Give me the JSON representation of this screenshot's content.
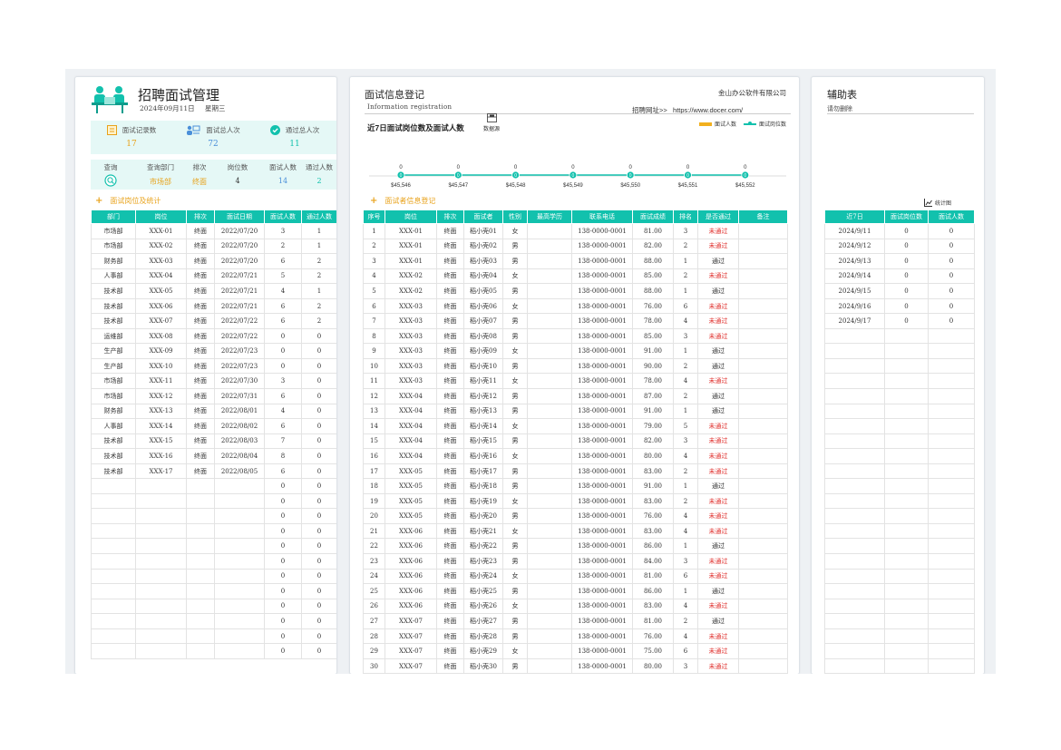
{
  "left": {
    "title": "招聘面试管理",
    "date": "2024年09月11日",
    "weekday": "星期三",
    "stats": [
      {
        "label": "面试记录数",
        "value": "17"
      },
      {
        "label": "面试总人次",
        "value": "72"
      },
      {
        "label": "通过总人次",
        "value": "11"
      }
    ],
    "query": {
      "headers": [
        "查询",
        "查询部门",
        "排次",
        "岗位数",
        "面试人数",
        "通过人数"
      ],
      "dept": "市场部",
      "round": "终面",
      "positions": "4",
      "interviewees": "14",
      "passed": "2"
    },
    "section_title": "面试岗位及统计",
    "table": {
      "headers": [
        "部门",
        "岗位",
        "排次",
        "面试日期",
        "面试人数",
        "通过人数"
      ],
      "rows": [
        [
          "市场部",
          "XXX-01",
          "终面",
          "2022/07/20",
          "3",
          "1"
        ],
        [
          "市场部",
          "XXX-02",
          "终面",
          "2022/07/20",
          "2",
          "1"
        ],
        [
          "财务部",
          "XXX-03",
          "终面",
          "2022/07/20",
          "6",
          "2"
        ],
        [
          "人事部",
          "XXX-04",
          "终面",
          "2022/07/21",
          "5",
          "2"
        ],
        [
          "技术部",
          "XXX-05",
          "终面",
          "2022/07/21",
          "4",
          "1"
        ],
        [
          "技术部",
          "XXX-06",
          "终面",
          "2022/07/21",
          "6",
          "2"
        ],
        [
          "技术部",
          "XXX-07",
          "终面",
          "2022/07/22",
          "6",
          "2"
        ],
        [
          "运维部",
          "XXX-08",
          "终面",
          "2022/07/22",
          "0",
          "0"
        ],
        [
          "生产部",
          "XXX-09",
          "终面",
          "2022/07/23",
          "0",
          "0"
        ],
        [
          "生产部",
          "XXX-10",
          "终面",
          "2022/07/23",
          "0",
          "0"
        ],
        [
          "市场部",
          "XXX-11",
          "终面",
          "2022/07/30",
          "3",
          "0"
        ],
        [
          "市场部",
          "XXX-12",
          "终面",
          "2022/07/31",
          "6",
          "0"
        ],
        [
          "财务部",
          "XXX-13",
          "终面",
          "2022/08/01",
          "4",
          "0"
        ],
        [
          "人事部",
          "XXX-14",
          "终面",
          "2022/08/02",
          "6",
          "0"
        ],
        [
          "技术部",
          "XXX-15",
          "终面",
          "2022/08/03",
          "7",
          "0"
        ],
        [
          "技术部",
          "XXX-16",
          "终面",
          "2022/08/04",
          "8",
          "0"
        ],
        [
          "技术部",
          "XXX-17",
          "终面",
          "2022/08/05",
          "6",
          "0"
        ],
        [
          "",
          "",
          "",
          "",
          "0",
          "0"
        ],
        [
          "",
          "",
          "",
          "",
          "0",
          "0"
        ],
        [
          "",
          "",
          "",
          "",
          "0",
          "0"
        ],
        [
          "",
          "",
          "",
          "",
          "0",
          "0"
        ],
        [
          "",
          "",
          "",
          "",
          "0",
          "0"
        ],
        [
          "",
          "",
          "",
          "",
          "0",
          "0"
        ],
        [
          "",
          "",
          "",
          "",
          "0",
          "0"
        ],
        [
          "",
          "",
          "",
          "",
          "0",
          "0"
        ],
        [
          "",
          "",
          "",
          "",
          "0",
          "0"
        ],
        [
          "",
          "",
          "",
          "",
          "0",
          "0"
        ],
        [
          "",
          "",
          "",
          "",
          "0",
          "0"
        ],
        [
          "",
          "",
          "",
          "",
          "0",
          "0"
        ]
      ]
    }
  },
  "mid": {
    "title": "面试信息登记",
    "subtitle": "Information registration",
    "company": "金山办公软件有限公司",
    "url_label": "招聘网址>>",
    "url": "https://www.docer.com/",
    "datasource_label": "数据源",
    "section_title": "面试者信息登记",
    "table": {
      "headers": [
        "序号",
        "岗位",
        "排次",
        "面试者",
        "性别",
        "最高学历",
        "联系电话",
        "面试成绩",
        "排名",
        "是否通过",
        "备注"
      ],
      "rows": [
        [
          "1",
          "XXX-01",
          "终面",
          "稻小壳01",
          "女",
          "",
          "138-0000-0001",
          "81.00",
          "3",
          "未通过",
          ""
        ],
        [
          "2",
          "XXX-01",
          "终面",
          "稻小壳02",
          "男",
          "",
          "138-0000-0001",
          "82.00",
          "2",
          "未通过",
          ""
        ],
        [
          "3",
          "XXX-01",
          "终面",
          "稻小壳03",
          "男",
          "",
          "138-0000-0001",
          "88.00",
          "1",
          "通过",
          ""
        ],
        [
          "4",
          "XXX-02",
          "终面",
          "稻小壳04",
          "女",
          "",
          "138-0000-0001",
          "85.00",
          "2",
          "未通过",
          ""
        ],
        [
          "5",
          "XXX-02",
          "终面",
          "稻小壳05",
          "男",
          "",
          "138-0000-0001",
          "88.00",
          "1",
          "通过",
          ""
        ],
        [
          "6",
          "XXX-03",
          "终面",
          "稻小壳06",
          "女",
          "",
          "138-0000-0001",
          "76.00",
          "6",
          "未通过",
          ""
        ],
        [
          "7",
          "XXX-03",
          "终面",
          "稻小壳07",
          "男",
          "",
          "138-0000-0001",
          "78.00",
          "4",
          "未通过",
          ""
        ],
        [
          "8",
          "XXX-03",
          "终面",
          "稻小壳08",
          "男",
          "",
          "138-0000-0001",
          "85.00",
          "3",
          "未通过",
          ""
        ],
        [
          "9",
          "XXX-03",
          "终面",
          "稻小壳09",
          "女",
          "",
          "138-0000-0001",
          "91.00",
          "1",
          "通过",
          ""
        ],
        [
          "10",
          "XXX-03",
          "终面",
          "稻小壳10",
          "男",
          "",
          "138-0000-0001",
          "90.00",
          "2",
          "通过",
          ""
        ],
        [
          "11",
          "XXX-03",
          "终面",
          "稻小壳11",
          "女",
          "",
          "138-0000-0001",
          "78.00",
          "4",
          "未通过",
          ""
        ],
        [
          "12",
          "XXX-04",
          "终面",
          "稻小壳12",
          "男",
          "",
          "138-0000-0001",
          "87.00",
          "2",
          "通过",
          ""
        ],
        [
          "13",
          "XXX-04",
          "终面",
          "稻小壳13",
          "男",
          "",
          "138-0000-0001",
          "91.00",
          "1",
          "通过",
          ""
        ],
        [
          "14",
          "XXX-04",
          "终面",
          "稻小壳14",
          "女",
          "",
          "138-0000-0001",
          "79.00",
          "5",
          "未通过",
          ""
        ],
        [
          "15",
          "XXX-04",
          "终面",
          "稻小壳15",
          "男",
          "",
          "138-0000-0001",
          "82.00",
          "3",
          "未通过",
          ""
        ],
        [
          "16",
          "XXX-04",
          "终面",
          "稻小壳16",
          "女",
          "",
          "138-0000-0001",
          "80.00",
          "4",
          "未通过",
          ""
        ],
        [
          "17",
          "XXX-05",
          "终面",
          "稻小壳17",
          "男",
          "",
          "138-0000-0001",
          "83.00",
          "2",
          "未通过",
          ""
        ],
        [
          "18",
          "XXX-05",
          "终面",
          "稻小壳18",
          "男",
          "",
          "138-0000-0001",
          "91.00",
          "1",
          "通过",
          ""
        ],
        [
          "19",
          "XXX-05",
          "终面",
          "稻小壳19",
          "女",
          "",
          "138-0000-0001",
          "83.00",
          "2",
          "未通过",
          ""
        ],
        [
          "20",
          "XXX-05",
          "终面",
          "稻小壳20",
          "男",
          "",
          "138-0000-0001",
          "76.00",
          "4",
          "未通过",
          ""
        ],
        [
          "21",
          "XXX-06",
          "终面",
          "稻小壳21",
          "女",
          "",
          "138-0000-0001",
          "83.00",
          "4",
          "未通过",
          ""
        ],
        [
          "22",
          "XXX-06",
          "终面",
          "稻小壳22",
          "男",
          "",
          "138-0000-0001",
          "86.00",
          "1",
          "通过",
          ""
        ],
        [
          "23",
          "XXX-06",
          "终面",
          "稻小壳23",
          "男",
          "",
          "138-0000-0001",
          "84.00",
          "3",
          "未通过",
          ""
        ],
        [
          "24",
          "XXX-06",
          "终面",
          "稻小壳24",
          "女",
          "",
          "138-0000-0001",
          "81.00",
          "6",
          "未通过",
          ""
        ],
        [
          "25",
          "XXX-06",
          "终面",
          "稻小壳25",
          "男",
          "",
          "138-0000-0001",
          "86.00",
          "1",
          "通过",
          ""
        ],
        [
          "26",
          "XXX-06",
          "终面",
          "稻小壳26",
          "女",
          "",
          "138-0000-0001",
          "83.00",
          "4",
          "未通过",
          ""
        ],
        [
          "27",
          "XXX-07",
          "终面",
          "稻小壳27",
          "男",
          "",
          "138-0000-0001",
          "81.00",
          "2",
          "通过",
          ""
        ],
        [
          "28",
          "XXX-07",
          "终面",
          "稻小壳28",
          "男",
          "",
          "138-0000-0001",
          "76.00",
          "4",
          "未通过",
          ""
        ],
        [
          "29",
          "XXX-07",
          "终面",
          "稻小壳29",
          "女",
          "",
          "138-0000-0001",
          "75.00",
          "6",
          "未通过",
          ""
        ],
        [
          "30",
          "XXX-07",
          "终面",
          "稻小壳30",
          "男",
          "",
          "138-0000-0001",
          "80.00",
          "3",
          "未通过",
          ""
        ]
      ]
    }
  },
  "right": {
    "title": "辅助表",
    "subtitle": "请勿删除",
    "chart_button": "统计图",
    "table": {
      "headers": [
        "近7日",
        "面试岗位数",
        "面试人数"
      ],
      "rows": [
        [
          "2024/9/11",
          "0",
          "0"
        ],
        [
          "2024/9/12",
          "0",
          "0"
        ],
        [
          "2024/9/13",
          "0",
          "0"
        ],
        [
          "2024/9/14",
          "0",
          "0"
        ],
        [
          "2024/9/15",
          "0",
          "0"
        ],
        [
          "2024/9/16",
          "0",
          "0"
        ],
        [
          "2024/9/17",
          "0",
          "0"
        ],
        [
          "",
          "",
          ""
        ],
        [
          "",
          "",
          ""
        ],
        [
          "",
          "",
          ""
        ],
        [
          "",
          "",
          ""
        ],
        [
          "",
          "",
          ""
        ],
        [
          "",
          "",
          ""
        ],
        [
          "",
          "",
          ""
        ],
        [
          "",
          "",
          ""
        ],
        [
          "",
          "",
          ""
        ],
        [
          "",
          "",
          ""
        ],
        [
          "",
          "",
          ""
        ],
        [
          "",
          "",
          ""
        ],
        [
          "",
          "",
          ""
        ],
        [
          "",
          "",
          ""
        ],
        [
          "",
          "",
          ""
        ],
        [
          "",
          "",
          ""
        ],
        [
          "",
          "",
          ""
        ],
        [
          "",
          "",
          ""
        ],
        [
          "",
          "",
          ""
        ],
        [
          "",
          "",
          ""
        ],
        [
          "",
          "",
          ""
        ],
        [
          "",
          "",
          ""
        ],
        [
          "",
          "",
          ""
        ]
      ]
    }
  },
  "colors": {
    "accent": "#12c1ad",
    "highlight": "#e8a21a",
    "fail": "#e0322f",
    "link": "#4a8fd9"
  },
  "chart_data": {
    "type": "line",
    "title": "近7日面试岗位数及面试人数",
    "categories": [
      "$45,546",
      "$45,547",
      "$45,548",
      "$45,549",
      "$45,550",
      "$45,551",
      "$45,552"
    ],
    "series": [
      {
        "name": "面试人数",
        "type": "bar",
        "values": [
          0,
          0,
          0,
          0,
          0,
          0,
          0
        ]
      },
      {
        "name": "面试岗位数",
        "type": "line",
        "values": [
          0,
          0,
          0,
          0,
          0,
          0,
          0
        ]
      }
    ],
    "legend": "top-right"
  }
}
